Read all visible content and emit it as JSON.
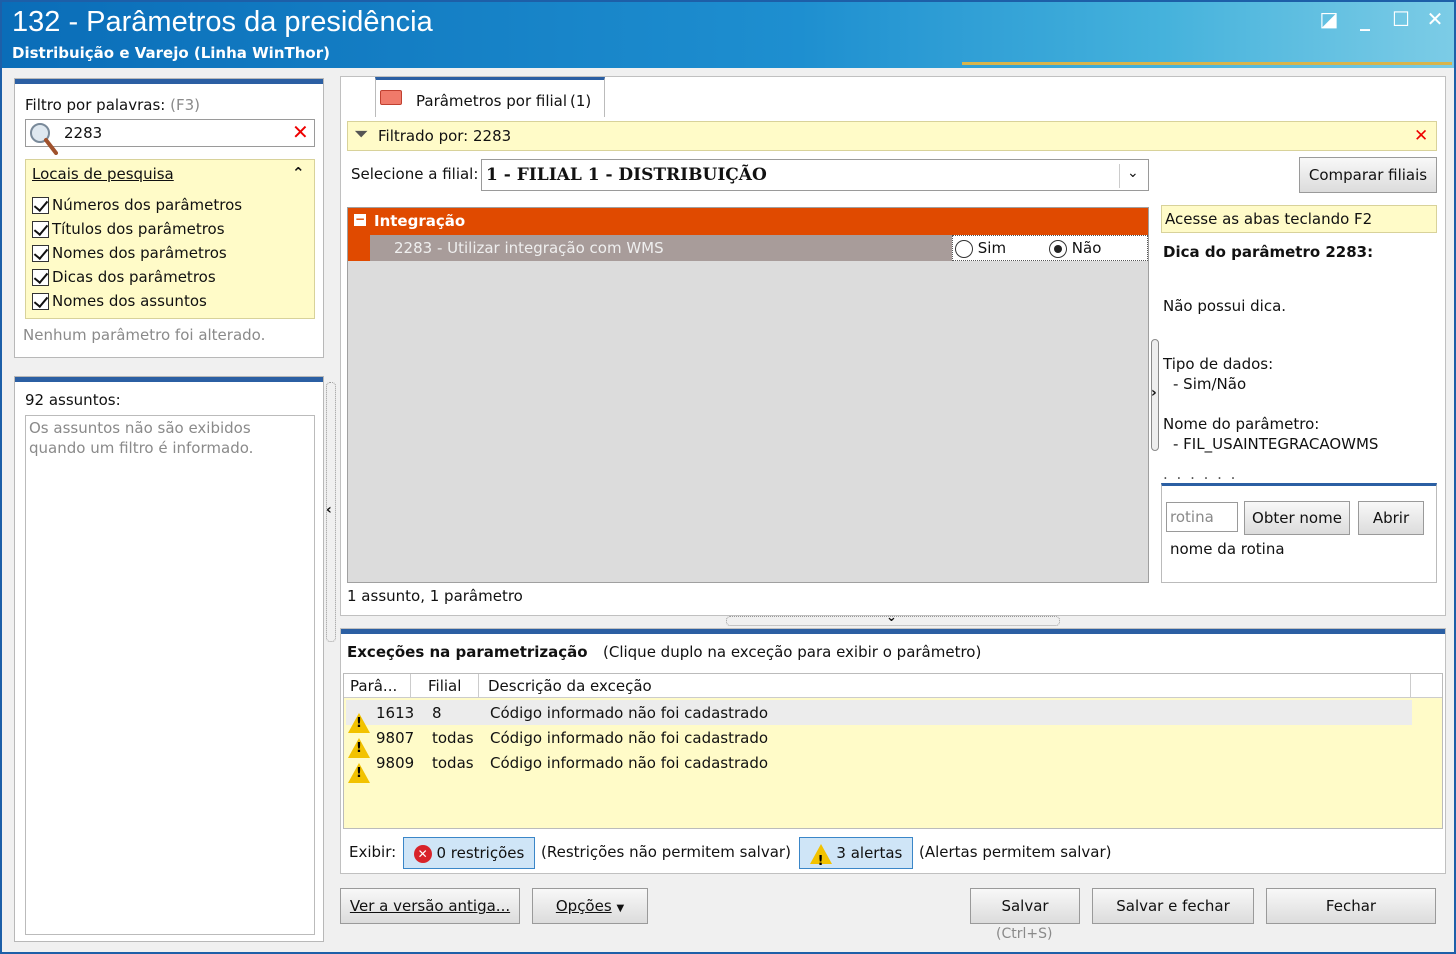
{
  "window": {
    "title": "132 - Parâmetros da presidência",
    "subtitle": "Distribuição e Varejo (Linha WinThor)",
    "buttons": {
      "restore": "◪",
      "minimize": "_",
      "maximize": "☐",
      "close": "✕"
    }
  },
  "filter": {
    "label": "Filtro por palavras:",
    "shortcut": "(F3)",
    "value": "2283",
    "search_locations_title": "Locais de pesquisa",
    "options": [
      "Números dos parâmetros",
      "Títulos dos parâmetros",
      "Nomes dos parâmetros",
      "Dicas dos parâmetros",
      "Nomes dos assuntos"
    ],
    "status": "Nenhum parâmetro foi alterado."
  },
  "subjects": {
    "count_label": "92 assuntos:",
    "message": "Os assuntos não são exibidos quando um filtro é informado."
  },
  "tab": {
    "label": "Parâmetros por filial",
    "count": "(1)"
  },
  "filtered": {
    "label": "Filtrado por: 2283"
  },
  "branch": {
    "label": "Selecione a filial:",
    "selected": "1 - FILIAL 1 - DISTRIBUIÇÃO",
    "compare_button": "Comparar filiais"
  },
  "parameters": {
    "group": "Integração",
    "item": "2283 - Utilizar integração com WMS",
    "options": [
      "Sim",
      "Não"
    ],
    "selected": "Não",
    "summary": "1 assunto, 1 parâmetro"
  },
  "tip": {
    "hint": "Acesse as abas teclando F2",
    "title": "Dica do parâmetro 2283:",
    "text": "Não possui dica.",
    "data_type_label": "Tipo de dados:",
    "data_type_value": "- Sim/Não",
    "param_name_label": "Nome do parâmetro:",
    "param_name_value": "- FIL_USAINTEGRACAOWMS",
    "routine_placeholder": "rotina",
    "get_name_button": "Obter nome",
    "open_button": "Abrir",
    "routine_name": "nome da rotina"
  },
  "exceptions": {
    "title": "Exceções na parametrização",
    "hint": "(Clique duplo na exceção para exibir o parâmetro)",
    "columns": [
      "Parâ...",
      "Filial",
      "Descrição da exceção"
    ],
    "rows": [
      {
        "param": "1613",
        "branch": "8",
        "description": "Código informado não foi cadastrado"
      },
      {
        "param": "9807",
        "branch": "todas",
        "description": "Código informado não foi cadastrado"
      },
      {
        "param": "9809",
        "branch": "todas",
        "description": "Código informado não foi cadastrado"
      }
    ],
    "show_label": "Exibir:",
    "restrictions_button": "0 restrições",
    "restrictions_note": "(Restrições não permitem salvar)",
    "alerts_button": "3 alertas",
    "alerts_note": "(Alertas permitem salvar)"
  },
  "footer": {
    "old_version": "Ver a versão antiga...",
    "options": "Opções",
    "save": "Salvar",
    "save_shortcut": "(Ctrl+S)",
    "save_close": "Salvar e fechar",
    "close": "Fechar"
  },
  "colors": {
    "titlebar": "#0a6db8",
    "group_header": "#e04a00",
    "selected_row": "#a89c9a",
    "note_yellow": "#fffbc8",
    "panel_accent": "#2b5fa3"
  }
}
